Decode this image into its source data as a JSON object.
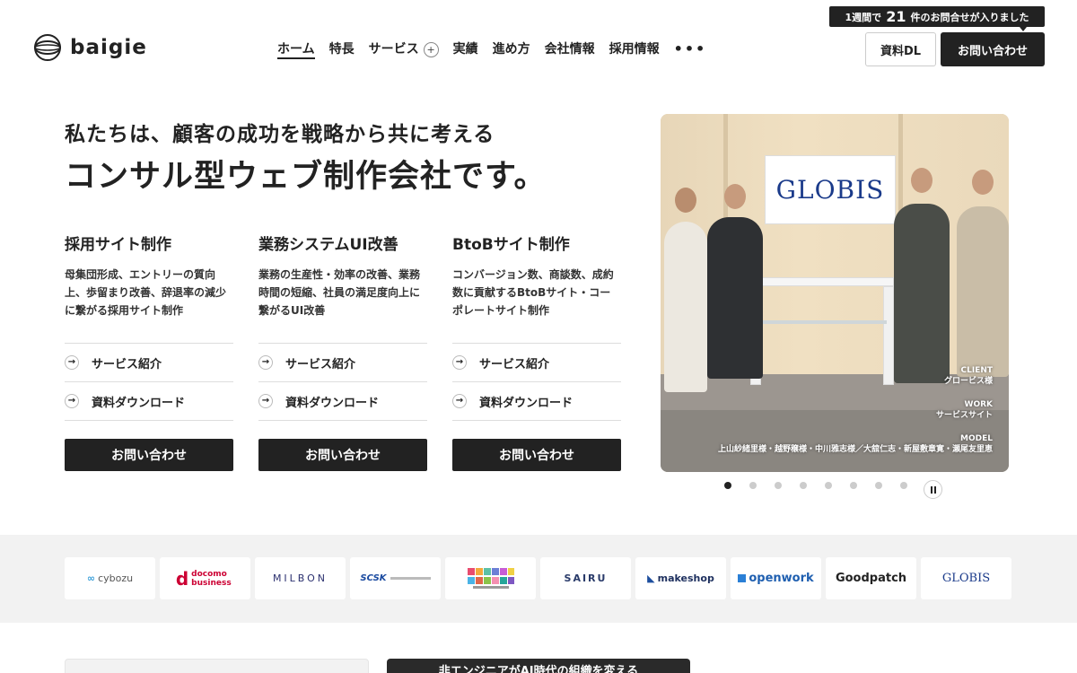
{
  "header": {
    "logo_text": "baigie",
    "nav": [
      {
        "label": "ホーム"
      },
      {
        "label": "特長"
      },
      {
        "label": "サービス"
      },
      {
        "label": "実績"
      },
      {
        "label": "進め方"
      },
      {
        "label": "会社情報"
      },
      {
        "label": "採用情報"
      }
    ],
    "more_label": "•••",
    "notice": {
      "prefix": "1週間で",
      "count": "21",
      "suffix": "件のお問合せが入りました"
    },
    "download_label": "資料DL",
    "contact_label": "お問い合わせ"
  },
  "hero": {
    "subtitle": "私たちは、顧客の成功を戦略から共に考える",
    "title": "コンサル型ウェブ制作会社です。"
  },
  "services": [
    {
      "title": "採用サイト制作",
      "desc": "母集団形成、エントリーの質向上、歩留まり改善、辞退率の減少に繋がる採用サイト制作",
      "link1": "サービス紹介",
      "link2": "資料ダウンロード",
      "cta": "お問い合わせ"
    },
    {
      "title": "業務システムUI改善",
      "desc": "業務の生産性・効率の改善、業務時間の短縮、社員の満足度向上に繋がるUI改善",
      "link1": "サービス紹介",
      "link2": "資料ダウンロード",
      "cta": "お問い合わせ"
    },
    {
      "title": "BtoBサイト制作",
      "desc": "コンバージョン数、商談数、成約数に貢献するBtoBサイト・コーポレートサイト制作",
      "link1": "サービス紹介",
      "link2": "資料ダウンロード",
      "cta": "お問い合わせ"
    }
  ],
  "slide": {
    "sign_text": "GLOBIS",
    "client_label": "CLIENT",
    "client_value": "グロービス様",
    "work_label": "WORK",
    "work_value": "サービスサイト",
    "model_label": "MODEL",
    "model_value": "上山紗緒里様・越野穣様・中川雅志様／大舘仁志・新屋敷章寛・瀬尾友里恵",
    "dot_count": 8,
    "active_index": 0
  },
  "clients": [
    "cybozu",
    "docomo business",
    "MILBON",
    "SCSK",
    "",
    "SAIRU",
    "makeshop",
    "openwork",
    "Goodpatch",
    "GLOBIS"
  ],
  "bottom": {
    "card_b_text": "非エンジニアがAI時代の組織を変える"
  }
}
